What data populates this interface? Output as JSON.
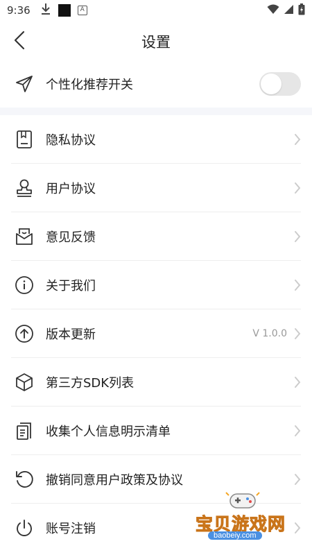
{
  "status_bar": {
    "time": "9:36",
    "icon_a": "A"
  },
  "nav": {
    "title": "设置"
  },
  "toggle_row": {
    "label": "个性化推荐开关",
    "enabled": false
  },
  "menu": {
    "items": [
      {
        "label": "隐私协议",
        "icon": "document-icon",
        "value": ""
      },
      {
        "label": "用户协议",
        "icon": "user-stamp-icon",
        "value": ""
      },
      {
        "label": "意见反馈",
        "icon": "feedback-envelope-icon",
        "value": ""
      },
      {
        "label": "关于我们",
        "icon": "info-icon",
        "value": ""
      },
      {
        "label": "版本更新",
        "icon": "upgrade-arrow-icon",
        "value": "V 1.0.0"
      },
      {
        "label": "第三方SDK列表",
        "icon": "cube-icon",
        "value": ""
      },
      {
        "label": "收集个人信息明示清单",
        "icon": "list-document-icon",
        "value": ""
      },
      {
        "label": "撤销同意用户政策及协议",
        "icon": "revoke-icon",
        "value": ""
      },
      {
        "label": "账号注销",
        "icon": "power-icon",
        "value": ""
      }
    ]
  },
  "watermark": {
    "text": "宝贝游戏网",
    "url": "baobeiy.com"
  },
  "colors": {
    "toggle_off": "#e6e6e6",
    "chevron": "#cccccc",
    "divider": "#eeeeee",
    "section_gap": "#f5f6fa"
  }
}
